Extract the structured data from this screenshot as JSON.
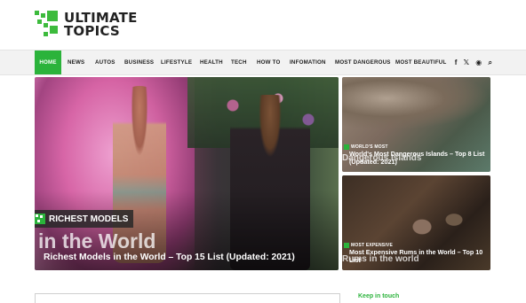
{
  "logo": {
    "line1": "ULTIMATE",
    "line2": "TOPICS",
    "brand_color": "#3dbb3d"
  },
  "nav": {
    "items": [
      "HOME",
      "NEWS",
      "AUTOS",
      "BUSINESS",
      "LIFESTYLE",
      "HEALTH",
      "TECH",
      "HOW TO",
      "INFOMATION",
      "MOST DANGEROUS",
      "MOST BEAUTIFUL"
    ],
    "active": "HOME",
    "icons": [
      "facebook-icon",
      "twitter-icon",
      "rss-icon",
      "search-icon"
    ],
    "icon_glyphs": [
      "f",
      "𝕏",
      "◉",
      "⌕"
    ],
    "accent": "#2bb33b"
  },
  "featured": {
    "main": {
      "category": "RICHEST MODELS",
      "image_text": "in the World",
      "headline": "Richest Models in the World – Top 15 List (Updated: 2021)"
    },
    "side1": {
      "category": "WORLD'S MOST",
      "image_text": "Dangerous Islands",
      "headline": "World's Most Dangerous Islands – Top 8 List (Updated: 2021)"
    },
    "side2": {
      "category": "MOST EXPENSIVE",
      "image_text": "Rums in the world",
      "headline": "Most Expensive Rums in the World – Top 10 List"
    }
  },
  "sidebar": {
    "keep_in_touch": "Keep in touch"
  }
}
